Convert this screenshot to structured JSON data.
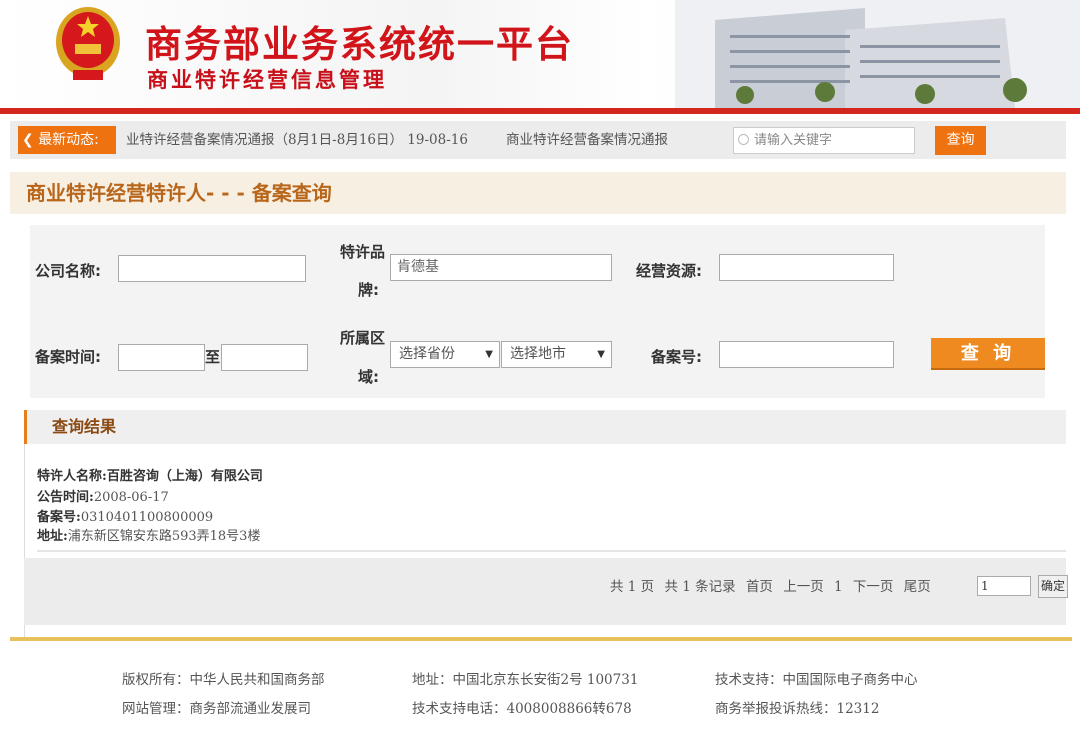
{
  "header": {
    "title": "商务部业务系统统一平台",
    "subtitle": "商业特许经营信息管理"
  },
  "news": {
    "label": "最新动态:",
    "items": [
      "业特许经营备案情况通报（8月1日-8月16日） 19-08-16",
      "商业特许经营备案情况通报"
    ]
  },
  "search": {
    "placeholder": "请输入关键字",
    "button": "查询"
  },
  "page_title": "商业特许经营特许人- - - 备案查询",
  "form": {
    "company_label": "公司名称:",
    "company_value": "",
    "brand_label_1": "特许品",
    "brand_label_2": "牌:",
    "brand_value": "肯德基",
    "resource_label": "经营资源:",
    "resource_value": "",
    "date_label": "备案时间:",
    "date_to": "至",
    "region_label_1": "所属区",
    "region_label_2": "域:",
    "province": "选择省份",
    "city": "选择地市",
    "record_label": "备案号:",
    "record_value": "",
    "query_button": "查 询"
  },
  "results": {
    "heading": "查询结果",
    "items": [
      {
        "name_label": "特许人名称:",
        "name": "百胜咨询（上海）有限公司",
        "date_label": "公告时间:",
        "date": "2008-06-17",
        "record_label": "备案号:",
        "record": "0310401100800009",
        "address_label": "地址:",
        "address": "浦东新区锦安东路593弄18号3楼"
      }
    ]
  },
  "pagination": {
    "total_pages": "共 1 页",
    "total_records": "共 1 条记录",
    "first": "首页",
    "prev": "上一页",
    "current": "1",
    "next": "下一页",
    "last": "尾页",
    "page_input": "1",
    "confirm": "确定"
  },
  "footer": {
    "row1": [
      "版权所有：中华人民共和国商务部",
      "地址：中国北京东长安街2号 100731",
      "技术支持：中国国际电子商务中心"
    ],
    "row2": [
      "网站管理：商务部流通业发展司",
      "技术支持电话：4008008866转678",
      "商务举报投诉热线：12312"
    ]
  },
  "colors": {
    "brand_red": "#d3261d",
    "accent_orange": "#ee7210",
    "title_brown": "#b8661a"
  }
}
